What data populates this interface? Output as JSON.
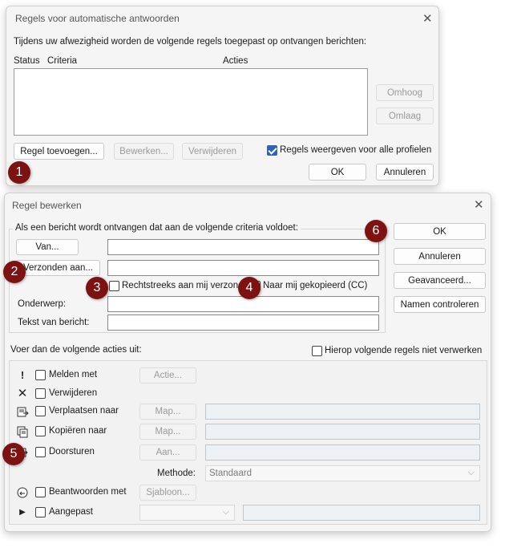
{
  "dialog1": {
    "title": "Regels voor automatische antwoorden",
    "description": "Tijdens uw afwezigheid worden de volgende regels toegepast op ontvangen berichten:",
    "columns": {
      "status": "Status",
      "criteria": "Criteria",
      "actions": "Acties"
    },
    "buttons": {
      "up": "Omhoog",
      "down": "Omlaag",
      "add": "Regel toevoegen...",
      "edit": "Bewerken...",
      "delete": "Verwijderen",
      "ok": "OK",
      "cancel": "Annuleren"
    },
    "show_all_profiles": "Regels weergeven voor alle profielen",
    "show_all_checked": true
  },
  "dialog2": {
    "title": "Regel bewerken",
    "criteria_heading": "Als een bericht wordt ontvangen dat aan de volgende criteria voldoet:",
    "from_button": "Van...",
    "sent_to_button": "Verzonden aan...",
    "sent_directly": "Rechtstreeks aan mij verzonden",
    "cc_to_me": "Naar mij gekopieerd (CC)",
    "subject_label": "Onderwerp:",
    "body_label": "Tekst van bericht:",
    "side_buttons": {
      "ok": "OK",
      "cancel": "Annuleren",
      "advanced": "Geavanceerd...",
      "check_names": "Namen controleren"
    },
    "actions_heading": "Voer dan de volgende acties uit:",
    "stop_processing": "Hierop volgende regels niet verwerken",
    "actions": {
      "alert": {
        "label": "Melden met",
        "button": "Actie..."
      },
      "delete": {
        "label": "Verwijderen"
      },
      "move": {
        "label": "Verplaatsen naar",
        "button": "Map..."
      },
      "copy": {
        "label": "Kopiëren naar",
        "button": "Map..."
      },
      "forward": {
        "label": "Doorsturen",
        "button": "Aan..."
      },
      "method_label": "Methode:",
      "method_value": "Standaard",
      "reply": {
        "label": "Beantwoorden met",
        "button": "Sjabloon..."
      },
      "custom": {
        "label": "Aangepast"
      }
    }
  },
  "badges": [
    "1",
    "2",
    "3",
    "4",
    "5",
    "6"
  ],
  "colors": {
    "badge": "#7d1212",
    "accent": "#2a63c4"
  }
}
